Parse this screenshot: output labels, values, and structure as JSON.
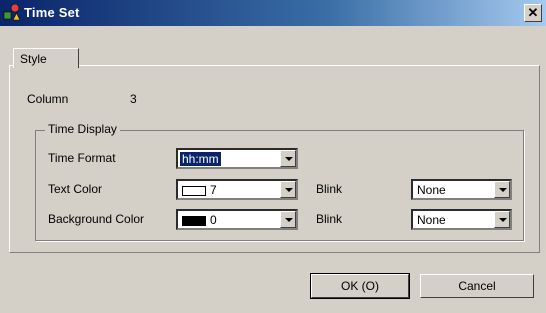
{
  "window": {
    "title": "Time Set",
    "close_glyph": "✕"
  },
  "tabs": [
    {
      "label": "Style"
    }
  ],
  "column": {
    "label": "Column",
    "value": "3"
  },
  "time_display": {
    "group_title": "Time Display",
    "time_format": {
      "label": "Time Format",
      "value": "hh:mm"
    },
    "text_color": {
      "label": "Text Color",
      "value": "7",
      "swatch": "#ffffff"
    },
    "background_color": {
      "label": "Background Color",
      "value": "0",
      "swatch": "#000000"
    },
    "text_blink": {
      "label": "Blink",
      "value": "None"
    },
    "background_blink": {
      "label": "Blink",
      "value": "None"
    }
  },
  "buttons": {
    "ok": "OK (O)",
    "cancel": "Cancel"
  },
  "icons": {
    "app": "palette-icon",
    "dropdown": "chevron-down-icon"
  }
}
